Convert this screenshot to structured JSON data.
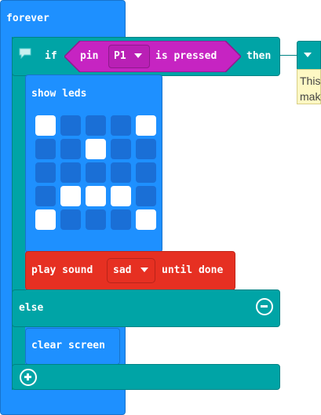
{
  "blocks": {
    "forever_label": "forever",
    "if_label": "if",
    "pin_label": "pin",
    "pin_value": "P1",
    "is_pressed_label": "is pressed",
    "then_label": "then",
    "show_leds_label": "show leds",
    "play_sound_label": "play sound",
    "sound_value": "sad",
    "until_done_label": "until done",
    "else_label": "else",
    "clear_screen_label": "clear screen"
  },
  "led_grid": [
    [
      1,
      0,
      0,
      0,
      1
    ],
    [
      0,
      0,
      1,
      0,
      0
    ],
    [
      0,
      0,
      0,
      0,
      0
    ],
    [
      0,
      1,
      1,
      1,
      0
    ],
    [
      1,
      0,
      0,
      0,
      1
    ]
  ],
  "tooltip": {
    "line1": "This",
    "line2": "mak"
  },
  "icons": {
    "comment": "comment-icon",
    "dropdown": "caret-down-icon",
    "add": "plus-circle-icon",
    "remove": "minus-circle-icon"
  },
  "colors": {
    "loops": "#1e90ff",
    "logic": "#00a4a6",
    "pins": "#c624c2",
    "music": "#e63022",
    "tooltip": "#fef8c4"
  }
}
